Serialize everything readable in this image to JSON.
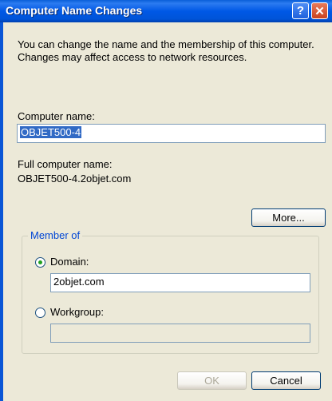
{
  "window": {
    "title": "Computer Name Changes",
    "help_glyph": "?",
    "close_glyph": "✕"
  },
  "intro_text": "You can change the name and the membership of this computer. Changes may affect access to network resources.",
  "computer_name": {
    "label": "Computer name:",
    "value": "OBJET500-4"
  },
  "full_name": {
    "label": "Full computer name:",
    "value": "OBJET500-4.2objet.com"
  },
  "more_button": "More...",
  "member_of": {
    "legend": "Member of",
    "domain_label": "Domain:",
    "domain_value": "2objet.com",
    "workgroup_label": "Workgroup:",
    "workgroup_value": "",
    "selected": "domain"
  },
  "buttons": {
    "ok": "OK",
    "cancel": "Cancel"
  },
  "colors": {
    "title_bar": "#0054e3",
    "dialog_bg": "#ece9d8",
    "selection": "#316ac5",
    "group_legend": "#0046d5"
  }
}
